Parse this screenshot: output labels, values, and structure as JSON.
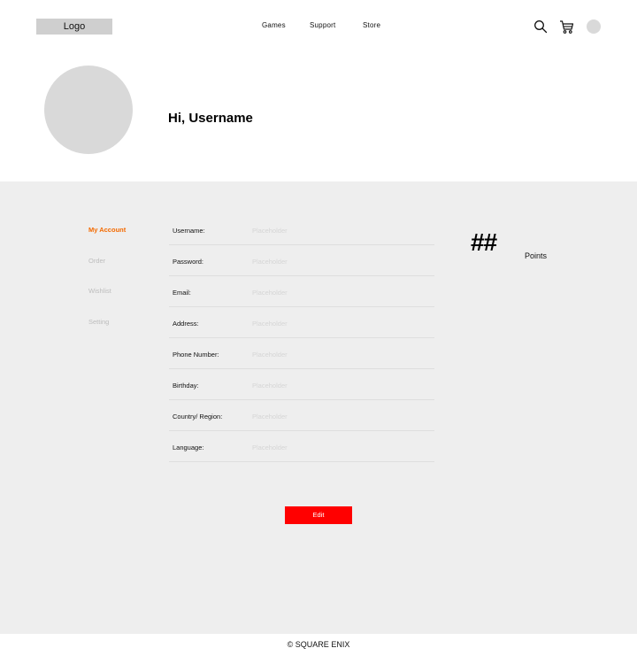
{
  "header": {
    "logo": "Logo",
    "nav": [
      "Games",
      "Support",
      "Store"
    ],
    "icons": [
      "search-icon",
      "cart-icon",
      "avatar"
    ]
  },
  "profile": {
    "greeting": "Hi, Username"
  },
  "sidebar": {
    "items": [
      {
        "label": "My Account",
        "active": true
      },
      {
        "label": "Order",
        "active": false
      },
      {
        "label": "Wishlist",
        "active": false
      },
      {
        "label": "Setting",
        "active": false
      }
    ],
    "active_color": "#f46a00"
  },
  "form": {
    "fields": [
      {
        "label": "Username:",
        "placeholder": "Placeholder"
      },
      {
        "label": "Password:",
        "placeholder": "Placeholder"
      },
      {
        "label": "Email:",
        "placeholder": "Placeholder"
      },
      {
        "label": "Address:",
        "placeholder": "Placeholder"
      },
      {
        "label": "Phone Number:",
        "placeholder": "Placeholder"
      },
      {
        "label": "Birthday:",
        "placeholder": "Placeholder"
      },
      {
        "label": "Country/ Region:",
        "placeholder": "Placeholder"
      },
      {
        "label": "Language:",
        "placeholder": "Placeholder"
      }
    ],
    "edit_label": "Edit",
    "edit_color": "#ff0000"
  },
  "points": {
    "value": "##",
    "label": "Points"
  },
  "footer": {
    "copyright": "© SQUARE ENIX"
  }
}
